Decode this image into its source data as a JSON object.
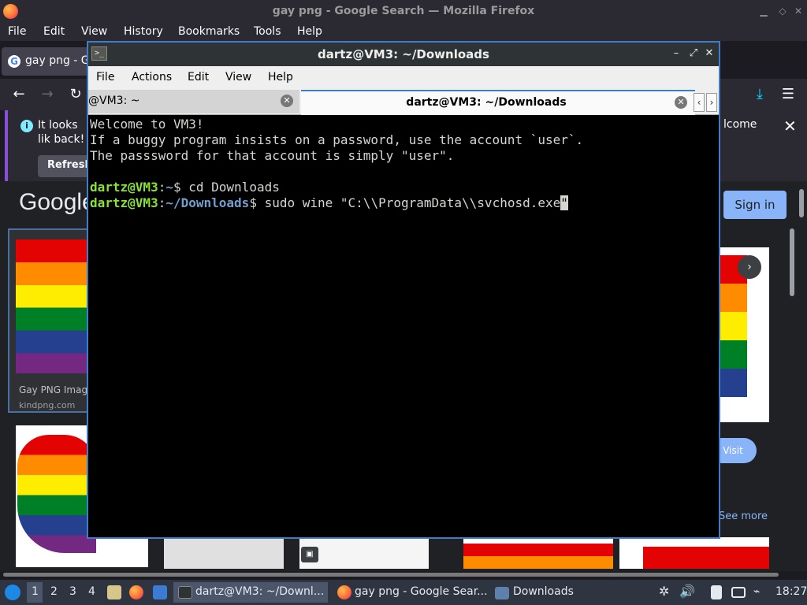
{
  "firefox": {
    "window_title": "gay png - Google Search — Mozilla Firefox",
    "menu": [
      "File",
      "Edit",
      "View",
      "History",
      "Bookmarks",
      "Tools",
      "Help"
    ],
    "tab_title": "gay png - G",
    "notification": {
      "message_left": "It looks lik back!",
      "message_right": "lcome",
      "refresh_label": "Refresh"
    }
  },
  "google": {
    "logo": "Google",
    "signin_label": "Sign in",
    "card": {
      "caption": "Gay PNG Image",
      "source": "kindpng.com"
    },
    "visit_label": "Visit",
    "see_more_label": "See more"
  },
  "terminal": {
    "window_title": "dartz@VM3: ~/Downloads",
    "menu": [
      "File",
      "Actions",
      "Edit",
      "View",
      "Help"
    ],
    "tabs": [
      {
        "label": "@VM3: ~"
      },
      {
        "label": "dartz@VM3: ~/Downloads"
      }
    ],
    "lines": {
      "l1": "Welcome to VM3!",
      "l2": "If a buggy program insists on a password, use the account `user`.",
      "l3": "The passsword for that account is simply \"user\".",
      "p1_user": "dartz@VM3",
      "p1_path": "~",
      "p1_cmd": "$ cd Downloads",
      "p2_user": "dartz@VM3",
      "p2_path": "~/Downloads",
      "p2_cmd": "$ sudo wine \"C:\\\\ProgramData\\\\svchosd.exe",
      "cursor_char": "\""
    }
  },
  "taskbar": {
    "workspaces": [
      "1",
      "2",
      "3",
      "4"
    ],
    "tasks": [
      {
        "label": "dartz@VM3: ~/Downl..."
      },
      {
        "label": "gay png - Google Sear..."
      },
      {
        "label": "Downloads"
      }
    ],
    "clock": "18:27"
  }
}
